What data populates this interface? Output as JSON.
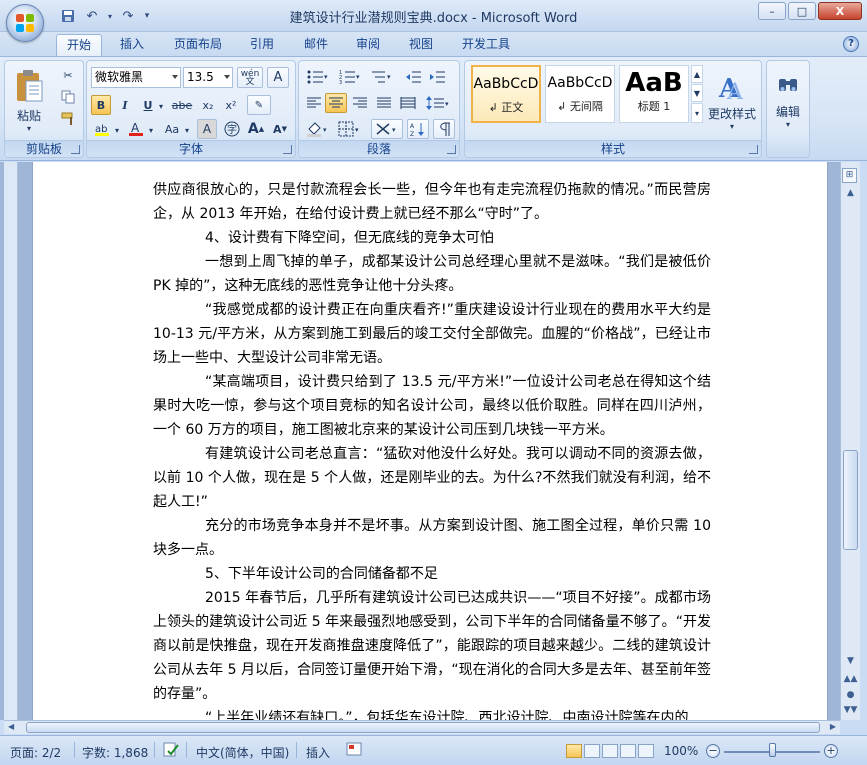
{
  "window": {
    "title": "建筑设计行业潜规则宝典.docx - Microsoft Word",
    "minimize": "–",
    "maximize": "□",
    "close": "X"
  },
  "qat": {
    "save_icon": "save-icon",
    "undo_icon": "undo-icon",
    "redo_icon": "redo-icon"
  },
  "tabs": [
    "开始",
    "插入",
    "页面布局",
    "引用",
    "邮件",
    "审阅",
    "视图",
    "开发工具"
  ],
  "ribbon": {
    "clipboard": {
      "label": "剪贴板",
      "paste": "粘贴"
    },
    "font": {
      "label": "字体",
      "font_name": "微软雅黑",
      "font_size": "13.5",
      "wen": "wén",
      "bold": "B",
      "italic": "I",
      "underline": "U",
      "strike": "abe",
      "sub": "x₂",
      "sup": "x²",
      "aa": "Aa",
      "grow": "A",
      "shrink": "A"
    },
    "paragraph": {
      "label": "段落"
    },
    "styles": {
      "label": "样式",
      "items": [
        {
          "sample": "AaBbCcD",
          "name": "↲ 正文"
        },
        {
          "sample": "AaBbCcD",
          "name": "↲ 无间隔"
        },
        {
          "sample": "AaB",
          "name": "标题 1"
        }
      ],
      "change": "更改样式"
    },
    "editing": {
      "label": "编辑"
    }
  },
  "document": {
    "paragraphs": [
      {
        "indent": false,
        "text": "供应商很放心的，只是付款流程会长一些，但今年也有走完流程仍拖款的情况。”而民营房企，从 2013 年开始，在给付设计费上就已经不那么“守时”了。"
      },
      {
        "indent": true,
        "text": "4、设计费有下降空间，但无底线的竞争太可怕"
      },
      {
        "indent": true,
        "text": "一想到上周飞掉的单子，成都某设计公司总经理心里就不是滋味。“我们是被低价 PK 掉的”，这种无底线的恶性竞争让他十分头疼。"
      },
      {
        "indent": true,
        "text": "“我感觉成都的设计费正在向重庆看齐!”重庆建设设计行业现在的费用水平大约是 10-13 元/平方米，从方案到施工到最后的竣工交付全部做完。血腥的“价格战”，已经让市场上一些中、大型设计公司非常无语。"
      },
      {
        "indent": true,
        "text": "“某高端项目，设计费只给到了 13.5 元/平方米!”一位设计公司老总在得知这个结果时大吃一惊，参与这个项目竞标的知名设计公司，最终以低价取胜。同样在四川泸州，一个 60 万方的项目，施工图被北京来的某设计公司压到几块钱一平方米。"
      },
      {
        "indent": true,
        "text": "有建筑设计公司老总直言：“猛砍对他没什么好处。我可以调动不同的资源去做，以前 10 个人做，现在是 5 个人做，还是刚毕业的去。为什么?不然我们就没有利润，给不起人工!”"
      },
      {
        "indent": true,
        "text": "充分的市场竞争本身并不是坏事。从方案到设计图、施工图全过程，单价只需 10 块多一点。"
      },
      {
        "indent": true,
        "text": "5、下半年设计公司的合同储备都不足"
      },
      {
        "indent": true,
        "text": "2015 年春节后，几乎所有建筑设计公司已达成共识——“项目不好接”。成都市场上领头的建筑设计公司近 5 年来最强烈地感受到，公司下半年的合同储备量不够了。“开发商以前是快推盘，现在开发商推盘速度降低了”，能跟踪的项目越来越少。二线的建筑设计公司从去年 5 月以后，合同签订量便开始下滑，“现在消化的合同大多是去年、甚至前年签的存量”。"
      },
      {
        "indent": true,
        "text": "“上半年业绩还有缺口。”，包括华东设计院、西北设计院、中南设计院等在内的"
      }
    ]
  },
  "status": {
    "page": "页面: 2/2",
    "words": "字数: 1,868",
    "language": "中文(简体，中国)",
    "mode": "插入",
    "zoom": "100%",
    "zoom_level": 0.5
  }
}
